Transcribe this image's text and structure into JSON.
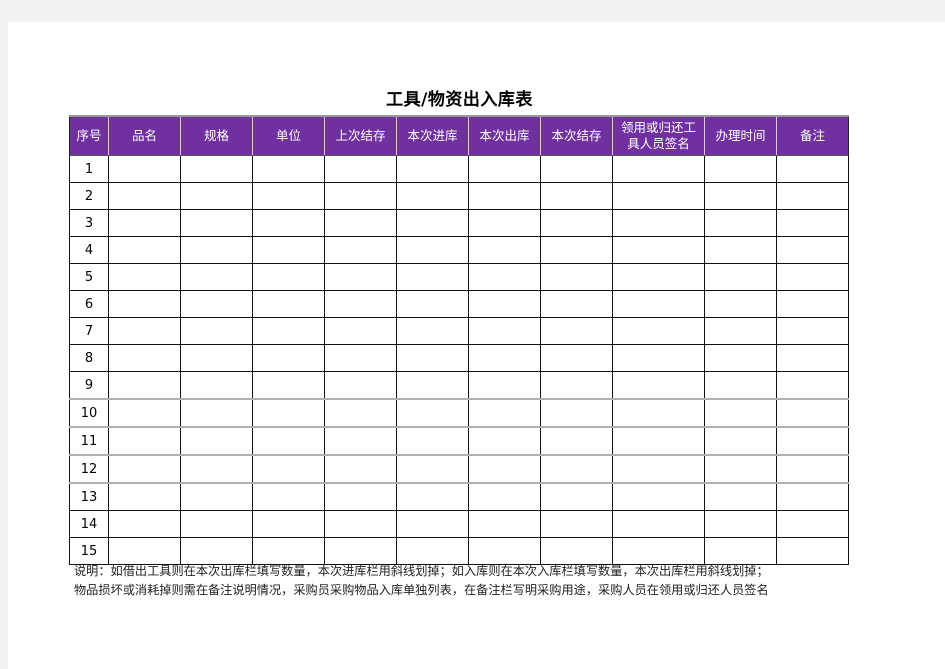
{
  "title": "工具/物资出入库表",
  "columns": [
    "序号",
    "品名",
    "规格",
    "单位",
    "上次结存",
    "本次进库",
    "本次出库",
    "本次结存",
    "领用或归还工具人员签名",
    "办理时间",
    "备注"
  ],
  "rows": [
    {
      "index": "1"
    },
    {
      "index": "2"
    },
    {
      "index": "3"
    },
    {
      "index": "4"
    },
    {
      "index": "5"
    },
    {
      "index": "6"
    },
    {
      "index": "7"
    },
    {
      "index": "8"
    },
    {
      "index": "9"
    },
    {
      "index": "10"
    },
    {
      "index": "11"
    },
    {
      "index": "12"
    },
    {
      "index": "13"
    },
    {
      "index": "14"
    },
    {
      "index": "15"
    }
  ],
  "notes": {
    "line1": "说明：如借出工具则在本次出库栏填写数量，本次进库栏用斜线划掉；如入库则在本次入库栏填写数量，本次出库栏用斜线划掉；",
    "line2": "物品损坏或消耗掉则需在备注说明情况，采购员采购物品入库单独列表，在备注栏写明采购用途，采购人员在领用或归还人员签名"
  },
  "colors": {
    "header_bg": "#7030a0",
    "header_text": "#ffffff",
    "page_bg": "#f3f3f3"
  }
}
